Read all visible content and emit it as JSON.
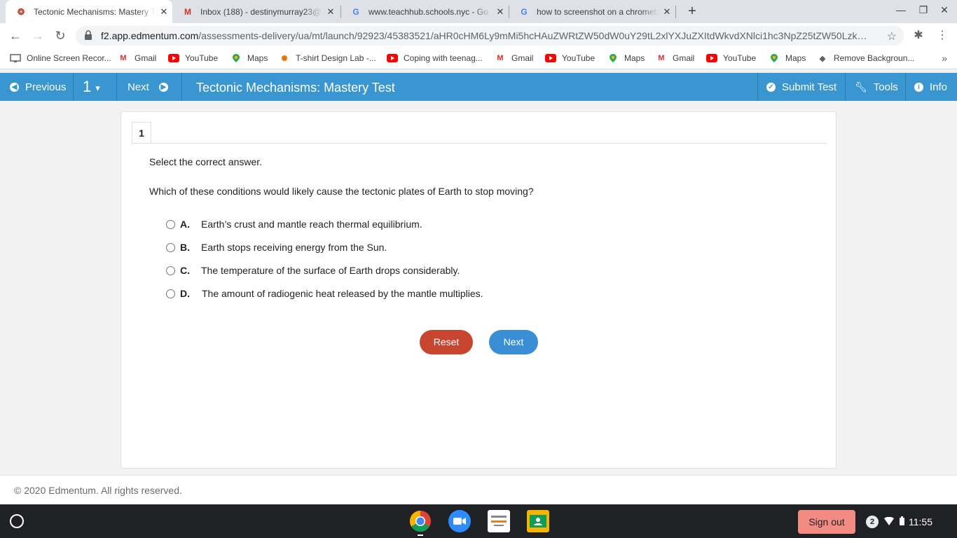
{
  "browser": {
    "tabs": [
      {
        "title": "Tectonic Mechanisms: Mastery T",
        "favicon": "edmentum-icon",
        "active": true
      },
      {
        "title": "Inbox (188) - destinymurray23@",
        "favicon": "gmail-icon",
        "active": false
      },
      {
        "title": "www.teachhub.schools.nyc - Go",
        "favicon": "google-icon",
        "active": false
      },
      {
        "title": "how to screenshot on a chromeb",
        "favicon": "google-icon",
        "active": false
      }
    ],
    "url_host": "f2.app.edmentum.com",
    "url_path": "/assessments-delivery/ua/mt/launch/92923/45383521/aHR0cHM6Ly9mMi5hcHAuZWRtZW50dW0uY29tL2xlYXJuZXItdWkvdXNlci1hc3NpZ25tZW50Lzk…",
    "bookmarks": [
      {
        "label": "Online Screen Recor...",
        "icon": "screen-icon"
      },
      {
        "label": "Gmail",
        "icon": "gmail-icon"
      },
      {
        "label": "YouTube",
        "icon": "youtube-icon"
      },
      {
        "label": "Maps",
        "icon": "maps-icon"
      },
      {
        "label": "T-shirt Design Lab -...",
        "icon": "tshirt-icon"
      },
      {
        "label": "Coping with teenag...",
        "icon": "youtube-icon"
      },
      {
        "label": "Gmail",
        "icon": "gmail-icon"
      },
      {
        "label": "YouTube",
        "icon": "youtube-icon"
      },
      {
        "label": "Maps",
        "icon": "maps-icon"
      },
      {
        "label": "Gmail",
        "icon": "gmail-icon"
      },
      {
        "label": "YouTube",
        "icon": "youtube-icon"
      },
      {
        "label": "Maps",
        "icon": "maps-icon"
      },
      {
        "label": "Remove Backgroun...",
        "icon": "layers-icon"
      }
    ]
  },
  "header": {
    "previous_label": "Previous",
    "question_number": "1",
    "next_label": "Next",
    "title": "Tectonic Mechanisms: Mastery Test",
    "submit_label": "Submit Test",
    "tools_label": "Tools",
    "info_label": "Info",
    "color": "#3a96d0"
  },
  "question": {
    "tab_number": "1",
    "instruction": "Select the correct answer.",
    "text": "Which of these conditions would likely cause the tectonic plates of Earth to stop moving?",
    "options": [
      {
        "letter": "A.",
        "text": "Earth’s crust and mantle reach thermal equilibrium."
      },
      {
        "letter": "B.",
        "text": "Earth stops receiving energy from the Sun."
      },
      {
        "letter": "C.",
        "text": "The temperature of the surface of Earth drops considerably."
      },
      {
        "letter": "D.",
        "text": "The amount of radiogenic heat released by the mantle multiplies."
      }
    ],
    "reset_label": "Reset",
    "next_label": "Next"
  },
  "footer": {
    "copyright": "© 2020 Edmentum. All rights reserved."
  },
  "shelf": {
    "sign_out_label": "Sign out",
    "notification_count": "2",
    "time": "11:55"
  }
}
